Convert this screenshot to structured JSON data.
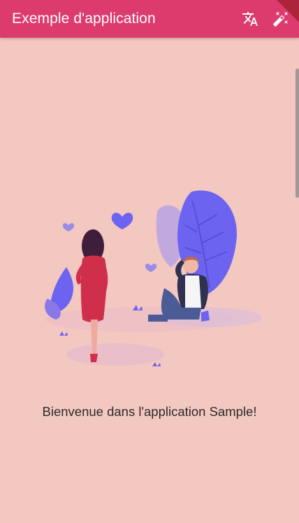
{
  "app_bar": {
    "title": "Exemple d'application",
    "background": "#dd3a6e",
    "actions": [
      {
        "name": "translate",
        "icon": "translate-icon"
      },
      {
        "name": "theme",
        "icon": "auto-fix-icon"
      }
    ]
  },
  "main": {
    "welcome_text": "Bienvenue dans l'application Sample!",
    "background": "#f3c8c1",
    "illustration": "couple-hearts-illustration"
  }
}
